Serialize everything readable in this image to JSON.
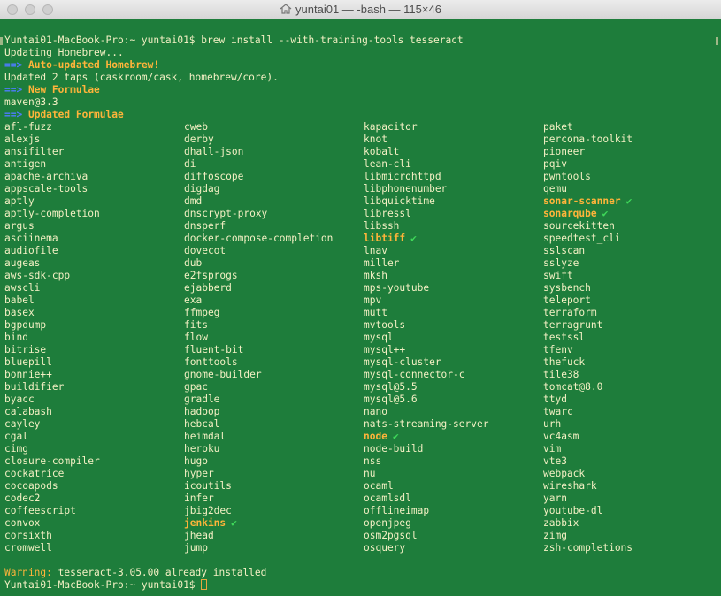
{
  "window": {
    "title": "yuntai01 — -bash — 115×46",
    "title_icon": "home-icon"
  },
  "terminal": {
    "prompt": "Yuntai01-MacBook-Pro:~ yuntai01$",
    "command": "brew install --with-training-tools tesseract",
    "output": {
      "updating": "Updating Homebrew...",
      "arrow": "==>",
      "auto_updated": "Auto-updated Homebrew!",
      "updated_taps": "Updated 2 taps (caskroom/cask, homebrew/core).",
      "new_formulae_header": "New Formulae",
      "new_formula": "maven@3.3",
      "updated_formulae_header": "Updated Formulae"
    },
    "columns": [
      [
        {
          "name": "afl-fuzz"
        },
        {
          "name": "alexjs"
        },
        {
          "name": "ansifilter"
        },
        {
          "name": "antigen"
        },
        {
          "name": "apache-archiva"
        },
        {
          "name": "appscale-tools"
        },
        {
          "name": "aptly"
        },
        {
          "name": "aptly-completion"
        },
        {
          "name": "argus"
        },
        {
          "name": "asciinema"
        },
        {
          "name": "audiofile"
        },
        {
          "name": "augeas"
        },
        {
          "name": "aws-sdk-cpp"
        },
        {
          "name": "awscli"
        },
        {
          "name": "babel"
        },
        {
          "name": "basex"
        },
        {
          "name": "bgpdump"
        },
        {
          "name": "bind"
        },
        {
          "name": "bitrise"
        },
        {
          "name": "bluepill"
        },
        {
          "name": "bonnie++"
        },
        {
          "name": "buildifier"
        },
        {
          "name": "byacc"
        },
        {
          "name": "calabash"
        },
        {
          "name": "cayley"
        },
        {
          "name": "cgal"
        },
        {
          "name": "cimg"
        },
        {
          "name": "closure-compiler"
        },
        {
          "name": "cockatrice"
        },
        {
          "name": "cocoapods"
        },
        {
          "name": "codec2"
        },
        {
          "name": "coffeescript"
        },
        {
          "name": "convox"
        },
        {
          "name": "corsixth"
        },
        {
          "name": "cromwell"
        }
      ],
      [
        {
          "name": "cweb"
        },
        {
          "name": "derby"
        },
        {
          "name": "dhall-json"
        },
        {
          "name": "di"
        },
        {
          "name": "diffoscope"
        },
        {
          "name": "digdag"
        },
        {
          "name": "dmd"
        },
        {
          "name": "dnscrypt-proxy"
        },
        {
          "name": "dnsperf"
        },
        {
          "name": "docker-compose-completion"
        },
        {
          "name": "dovecot"
        },
        {
          "name": "dub"
        },
        {
          "name": "e2fsprogs"
        },
        {
          "name": "ejabberd"
        },
        {
          "name": "exa"
        },
        {
          "name": "ffmpeg"
        },
        {
          "name": "fits"
        },
        {
          "name": "flow"
        },
        {
          "name": "fluent-bit"
        },
        {
          "name": "fonttools"
        },
        {
          "name": "gnome-builder"
        },
        {
          "name": "gpac"
        },
        {
          "name": "gradle"
        },
        {
          "name": "hadoop"
        },
        {
          "name": "hebcal"
        },
        {
          "name": "heimdal"
        },
        {
          "name": "heroku"
        },
        {
          "name": "hugo"
        },
        {
          "name": "hyper"
        },
        {
          "name": "icoutils"
        },
        {
          "name": "infer"
        },
        {
          "name": "jbig2dec"
        },
        {
          "name": "jenkins",
          "installed": true,
          "check": "✔"
        },
        {
          "name": "jhead"
        },
        {
          "name": "jump"
        }
      ],
      [
        {
          "name": "kapacitor"
        },
        {
          "name": "knot"
        },
        {
          "name": "kobalt"
        },
        {
          "name": "lean-cli"
        },
        {
          "name": "libmicrohttpd"
        },
        {
          "name": "libphonenumber"
        },
        {
          "name": "libquicktime"
        },
        {
          "name": "libressl"
        },
        {
          "name": "libssh"
        },
        {
          "name": "libtiff",
          "installed": true,
          "check": "✔"
        },
        {
          "name": "lnav"
        },
        {
          "name": "miller"
        },
        {
          "name": "mksh"
        },
        {
          "name": "mps-youtube"
        },
        {
          "name": "mpv"
        },
        {
          "name": "mutt"
        },
        {
          "name": "mvtools"
        },
        {
          "name": "mysql"
        },
        {
          "name": "mysql++"
        },
        {
          "name": "mysql-cluster"
        },
        {
          "name": "mysql-connector-c"
        },
        {
          "name": "mysql@5.5"
        },
        {
          "name": "mysql@5.6"
        },
        {
          "name": "nano"
        },
        {
          "name": "nats-streaming-server"
        },
        {
          "name": "node",
          "installed": true,
          "check": "✔"
        },
        {
          "name": "node-build"
        },
        {
          "name": "nss"
        },
        {
          "name": "nu"
        },
        {
          "name": "ocaml"
        },
        {
          "name": "ocamlsdl"
        },
        {
          "name": "offlineimap"
        },
        {
          "name": "openjpeg"
        },
        {
          "name": "osm2pgsql"
        },
        {
          "name": "osquery"
        }
      ],
      [
        {
          "name": "paket"
        },
        {
          "name": "percona-toolkit"
        },
        {
          "name": "pioneer"
        },
        {
          "name": "pqiv"
        },
        {
          "name": "pwntools"
        },
        {
          "name": "qemu"
        },
        {
          "name": "sonar-scanner",
          "installed": true,
          "check": "✔"
        },
        {
          "name": "sonarqube",
          "installed": true,
          "check": "✔"
        },
        {
          "name": "sourcekitten"
        },
        {
          "name": "speedtest_cli"
        },
        {
          "name": "sslscan"
        },
        {
          "name": "sslyze"
        },
        {
          "name": "swift"
        },
        {
          "name": "sysbench"
        },
        {
          "name": "teleport"
        },
        {
          "name": "terraform"
        },
        {
          "name": "terragrunt"
        },
        {
          "name": "testssl"
        },
        {
          "name": "tfenv"
        },
        {
          "name": "thefuck"
        },
        {
          "name": "tile38"
        },
        {
          "name": "tomcat@8.0"
        },
        {
          "name": "ttyd"
        },
        {
          "name": "twarc"
        },
        {
          "name": "urh"
        },
        {
          "name": "vc4asm"
        },
        {
          "name": "vim"
        },
        {
          "name": "vte3"
        },
        {
          "name": "webpack"
        },
        {
          "name": "wireshark"
        },
        {
          "name": "yarn"
        },
        {
          "name": "youtube-dl"
        },
        {
          "name": "zabbix"
        },
        {
          "name": "zimg"
        },
        {
          "name": "zsh-completions"
        }
      ]
    ],
    "warning_label": "Warning:",
    "warning_text": "tesseract-3.05.00 already installed",
    "final_prompt": "Yuntai01-MacBook-Pro:~ yuntai01$"
  },
  "colors": {
    "background": "#1e7d3b",
    "text": "#f4f0c4",
    "arrow": "#4d7cff",
    "highlight": "#ffb43a",
    "check": "#3fd95a"
  }
}
